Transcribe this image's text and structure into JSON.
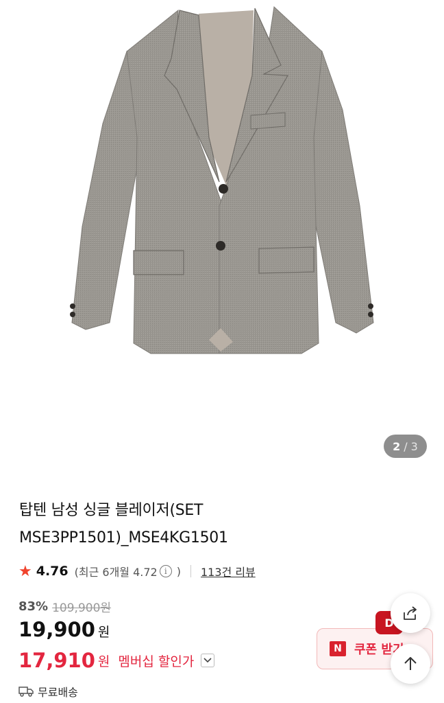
{
  "gallery": {
    "current": "2",
    "separator": "/",
    "total": "3"
  },
  "product": {
    "title_line1": "탑텐 남성 싱글 블레이저(SET",
    "title_line2": "MSE3PP1501)_MSE4KG1501"
  },
  "rating": {
    "score": "4.76",
    "recent_text": "(최근 6개월 4.72",
    "info_glyph": "i",
    "recent_close": ")",
    "reviews": "113건 리뷰"
  },
  "price": {
    "discount": "83%",
    "original": "109,900원",
    "current": "19,900",
    "unit": "원",
    "member_price": "17,910",
    "member_unit": "원",
    "member_label": "멤버십 할인가"
  },
  "shipping": {
    "label": "무료배송"
  },
  "coupon": {
    "badge": "N",
    "label": "쿠폰 받기",
    "d_badge": "D"
  },
  "colors": {
    "accent_red": "#e3263f",
    "star": "#f0432d",
    "indicator_bg": "#8e8e8e"
  },
  "icons": [
    "star-icon",
    "info-icon",
    "chevron-down-icon",
    "truck-icon",
    "share-icon",
    "arrow-up-icon"
  ]
}
